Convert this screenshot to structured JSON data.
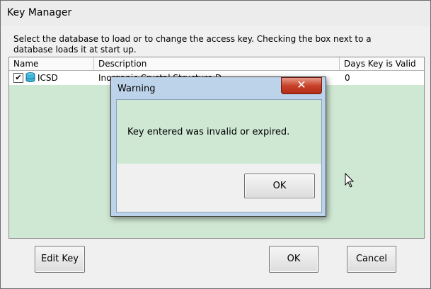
{
  "window": {
    "title": "Key Manager",
    "instructions": "Select the database to load or to change the access key.  Checking the box next to a database loads it at start up."
  },
  "list": {
    "columns": [
      "Name",
      "Description",
      "Days Key is Valid"
    ],
    "rows": [
      {
        "checked": true,
        "name": "ICSD",
        "description": "Inorganic Crystal Structure D",
        "days": "0"
      }
    ]
  },
  "buttons": {
    "edit_key": "Edit Key",
    "ok": "OK",
    "cancel": "Cancel"
  },
  "dialog": {
    "title": "Warning",
    "close_glyph": "✕",
    "message": "Key entered was invalid or expired.",
    "ok": "OK"
  },
  "colors": {
    "list_background": "#cfe8d3",
    "dialog_frame": "#bcd3ea",
    "close_button": "#c8422a"
  },
  "icons": [
    "checkbox-checked-icon",
    "database-icon",
    "close-icon",
    "mouse-cursor-icon"
  ]
}
